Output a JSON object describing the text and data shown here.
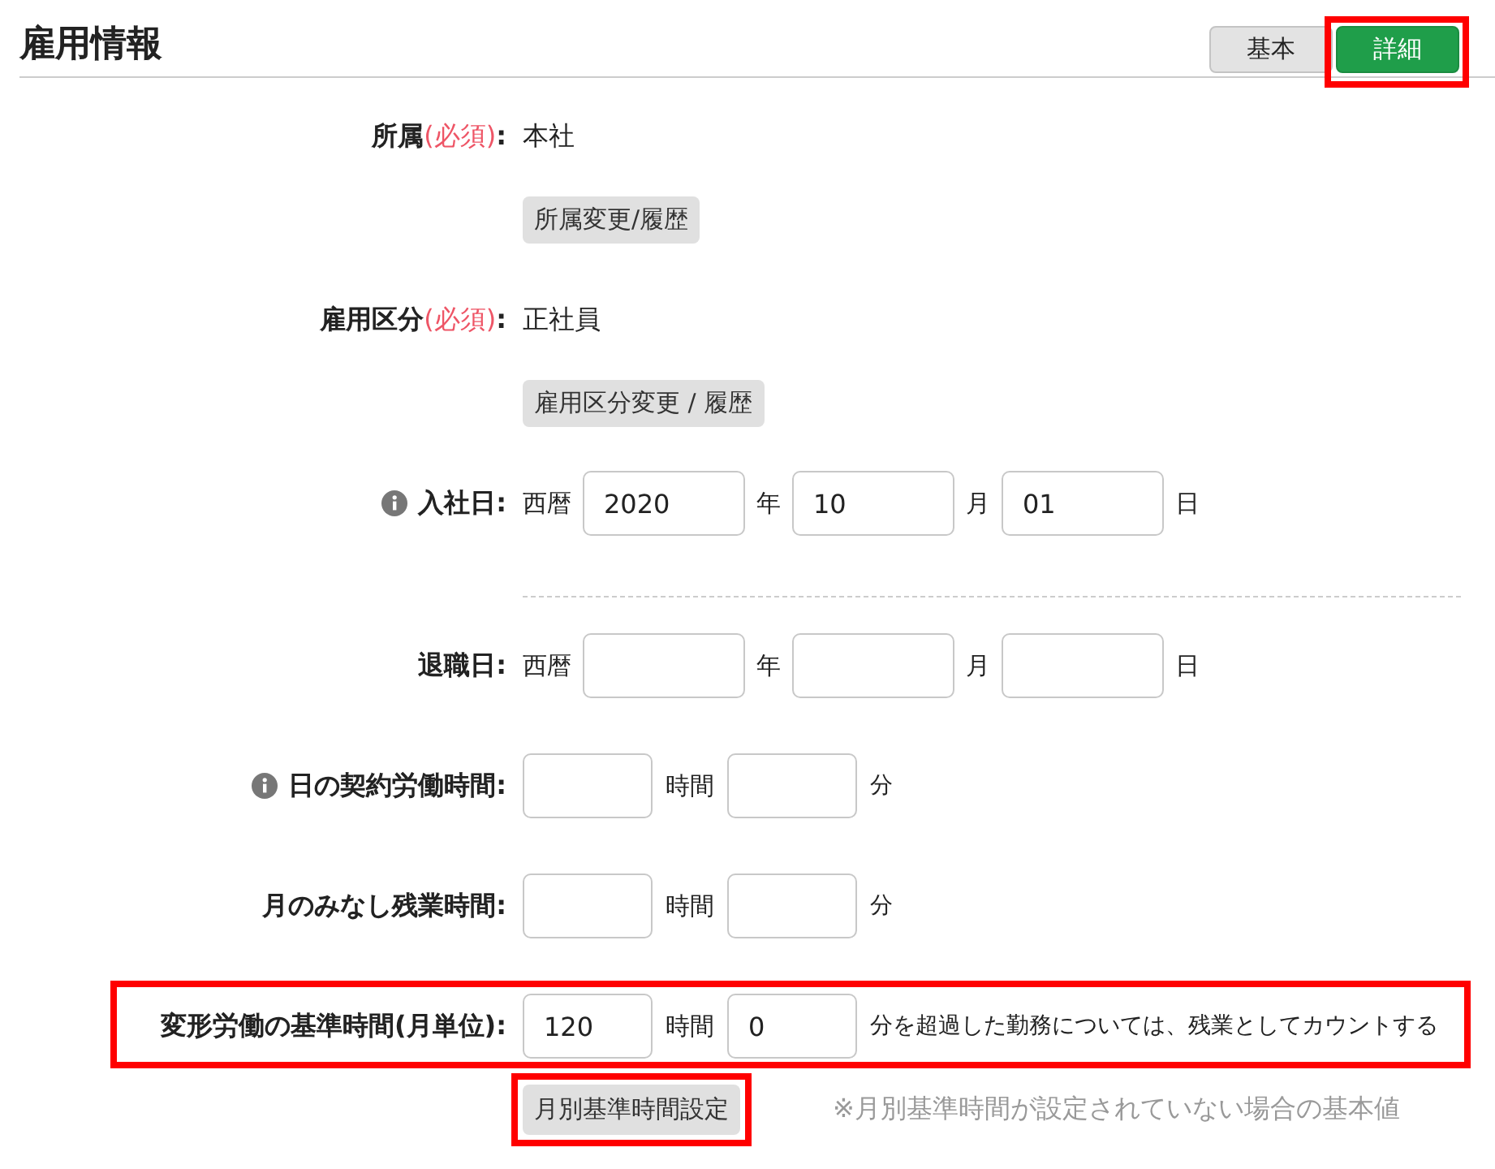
{
  "section": {
    "title": "雇用情報"
  },
  "view_tabs": [
    {
      "label": "基本",
      "selected": false,
      "highlighted": false
    },
    {
      "label": "詳細",
      "selected": true,
      "highlighted": true
    }
  ],
  "fields": [
    {
      "kind": "text",
      "info": false,
      "label": "所属",
      "required_mark": "(必須)",
      "colon": ":",
      "value": "本社"
    },
    {
      "kind": "button",
      "button": "所属変更/履歴",
      "highlighted": false
    },
    {
      "kind": "text",
      "info": false,
      "label": "雇用区分",
      "required_mark": "(必須)",
      "colon": ":",
      "value": "正社員"
    },
    {
      "kind": "button",
      "button": "雇用区分変更 / 履歴",
      "highlighted": false
    },
    {
      "kind": "date",
      "info": true,
      "label": "入社日",
      "colon": ":",
      "era": "西暦",
      "year": "2020",
      "year_unit": "年",
      "month": "10",
      "month_unit": "月",
      "day": "01",
      "day_unit": "日"
    },
    {
      "kind": "divider"
    },
    {
      "kind": "date",
      "info": false,
      "label": "退職日",
      "colon": ":",
      "era": "西暦",
      "year_unit": "年",
      "month_unit": "月",
      "day_unit": "日"
    },
    {
      "kind": "duration",
      "info": true,
      "label": "日の契約労働時間",
      "colon": ":",
      "hours_unit": "時間",
      "minutes_unit": "分",
      "highlighted": false
    },
    {
      "kind": "duration",
      "info": false,
      "label": "月のみなし残業時間",
      "colon": ":",
      "hours_unit": "時間",
      "minutes_unit": "分",
      "highlighted": false
    },
    {
      "kind": "duration",
      "info": false,
      "label": "変形労働の基準時間(月単位)",
      "colon": ":",
      "hours": "120",
      "hours_unit": "時間",
      "minutes": "0",
      "minutes_unit": "分を超過した勤務については、残業としてカウントする",
      "highlighted": true
    },
    {
      "kind": "button",
      "button": "月別基準時間設定",
      "note": "※月別基準時間が設定されていない場合の基本値",
      "highlighted": true
    }
  ]
}
